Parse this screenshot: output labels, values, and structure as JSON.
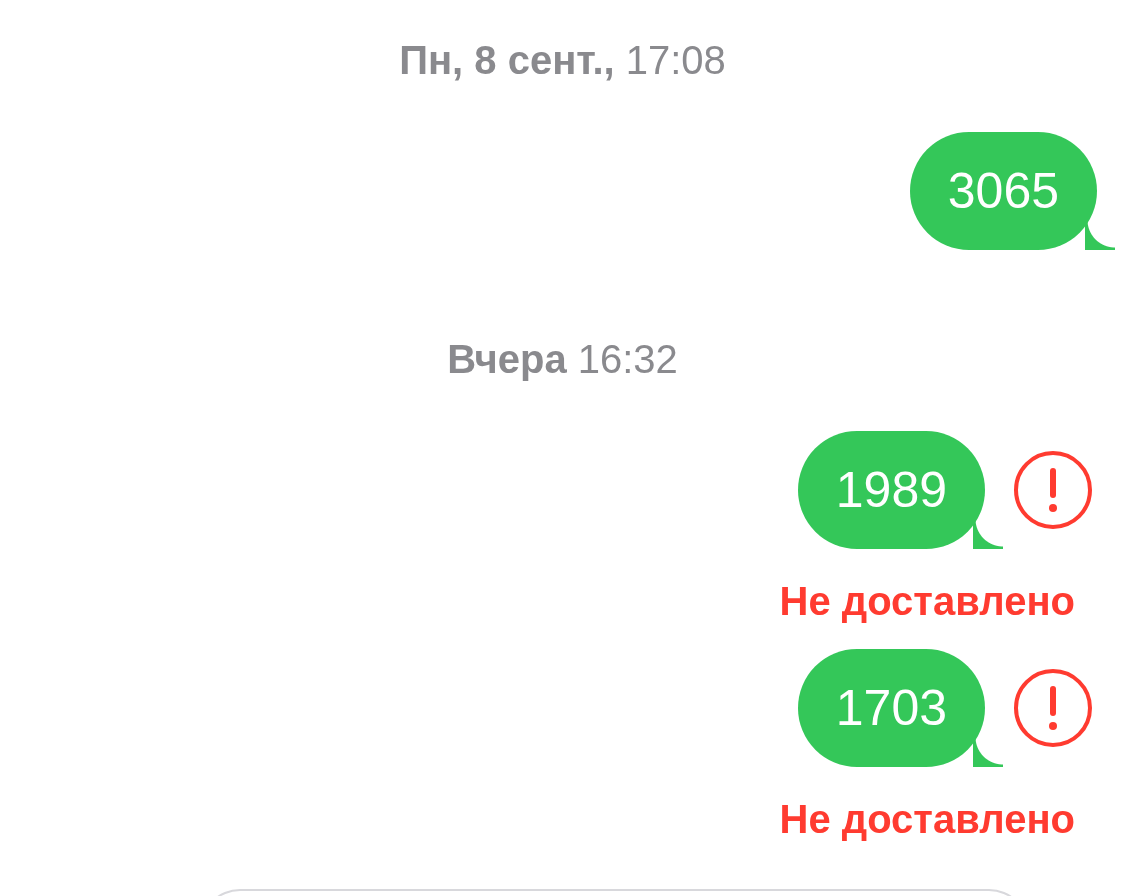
{
  "messages": [
    {
      "kind": "timestamp",
      "text": "**Пн, 8 сент.,** 17:08"
    },
    {
      "kind": "bubble",
      "text": "3065",
      "failed": false
    },
    {
      "kind": "timestamp",
      "text": "**Вчера** 16:32"
    },
    {
      "kind": "bubble",
      "text": "1989",
      "failed": true,
      "status": "Не доставлено"
    },
    {
      "kind": "bubble",
      "text": "1703",
      "failed": true,
      "status": "Не доставлено"
    }
  ]
}
